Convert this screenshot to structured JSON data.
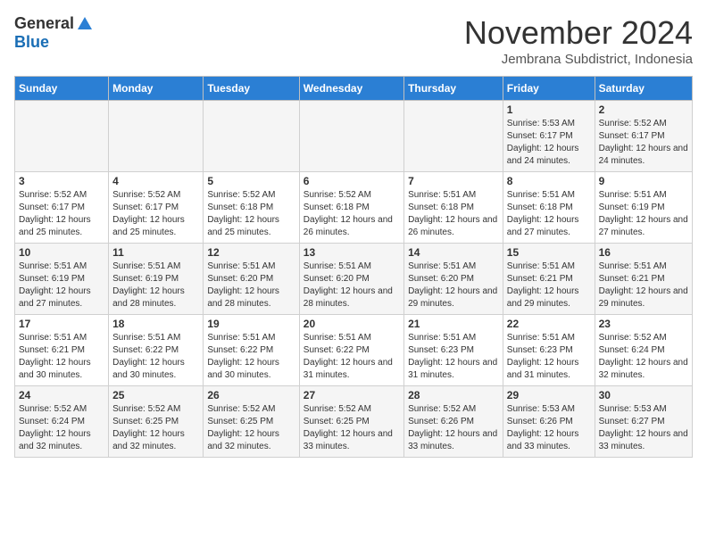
{
  "header": {
    "logo_general": "General",
    "logo_blue": "Blue",
    "month_title": "November 2024",
    "subtitle": "Jembrana Subdistrict, Indonesia"
  },
  "weekdays": [
    "Sunday",
    "Monday",
    "Tuesday",
    "Wednesday",
    "Thursday",
    "Friday",
    "Saturday"
  ],
  "weeks": [
    [
      {
        "day": "",
        "info": ""
      },
      {
        "day": "",
        "info": ""
      },
      {
        "day": "",
        "info": ""
      },
      {
        "day": "",
        "info": ""
      },
      {
        "day": "",
        "info": ""
      },
      {
        "day": "1",
        "info": "Sunrise: 5:53 AM\nSunset: 6:17 PM\nDaylight: 12 hours and 24 minutes."
      },
      {
        "day": "2",
        "info": "Sunrise: 5:52 AM\nSunset: 6:17 PM\nDaylight: 12 hours and 24 minutes."
      }
    ],
    [
      {
        "day": "3",
        "info": "Sunrise: 5:52 AM\nSunset: 6:17 PM\nDaylight: 12 hours and 25 minutes."
      },
      {
        "day": "4",
        "info": "Sunrise: 5:52 AM\nSunset: 6:17 PM\nDaylight: 12 hours and 25 minutes."
      },
      {
        "day": "5",
        "info": "Sunrise: 5:52 AM\nSunset: 6:18 PM\nDaylight: 12 hours and 25 minutes."
      },
      {
        "day": "6",
        "info": "Sunrise: 5:52 AM\nSunset: 6:18 PM\nDaylight: 12 hours and 26 minutes."
      },
      {
        "day": "7",
        "info": "Sunrise: 5:51 AM\nSunset: 6:18 PM\nDaylight: 12 hours and 26 minutes."
      },
      {
        "day": "8",
        "info": "Sunrise: 5:51 AM\nSunset: 6:18 PM\nDaylight: 12 hours and 27 minutes."
      },
      {
        "day": "9",
        "info": "Sunrise: 5:51 AM\nSunset: 6:19 PM\nDaylight: 12 hours and 27 minutes."
      }
    ],
    [
      {
        "day": "10",
        "info": "Sunrise: 5:51 AM\nSunset: 6:19 PM\nDaylight: 12 hours and 27 minutes."
      },
      {
        "day": "11",
        "info": "Sunrise: 5:51 AM\nSunset: 6:19 PM\nDaylight: 12 hours and 28 minutes."
      },
      {
        "day": "12",
        "info": "Sunrise: 5:51 AM\nSunset: 6:20 PM\nDaylight: 12 hours and 28 minutes."
      },
      {
        "day": "13",
        "info": "Sunrise: 5:51 AM\nSunset: 6:20 PM\nDaylight: 12 hours and 28 minutes."
      },
      {
        "day": "14",
        "info": "Sunrise: 5:51 AM\nSunset: 6:20 PM\nDaylight: 12 hours and 29 minutes."
      },
      {
        "day": "15",
        "info": "Sunrise: 5:51 AM\nSunset: 6:21 PM\nDaylight: 12 hours and 29 minutes."
      },
      {
        "day": "16",
        "info": "Sunrise: 5:51 AM\nSunset: 6:21 PM\nDaylight: 12 hours and 29 minutes."
      }
    ],
    [
      {
        "day": "17",
        "info": "Sunrise: 5:51 AM\nSunset: 6:21 PM\nDaylight: 12 hours and 30 minutes."
      },
      {
        "day": "18",
        "info": "Sunrise: 5:51 AM\nSunset: 6:22 PM\nDaylight: 12 hours and 30 minutes."
      },
      {
        "day": "19",
        "info": "Sunrise: 5:51 AM\nSunset: 6:22 PM\nDaylight: 12 hours and 30 minutes."
      },
      {
        "day": "20",
        "info": "Sunrise: 5:51 AM\nSunset: 6:22 PM\nDaylight: 12 hours and 31 minutes."
      },
      {
        "day": "21",
        "info": "Sunrise: 5:51 AM\nSunset: 6:23 PM\nDaylight: 12 hours and 31 minutes."
      },
      {
        "day": "22",
        "info": "Sunrise: 5:51 AM\nSunset: 6:23 PM\nDaylight: 12 hours and 31 minutes."
      },
      {
        "day": "23",
        "info": "Sunrise: 5:52 AM\nSunset: 6:24 PM\nDaylight: 12 hours and 32 minutes."
      }
    ],
    [
      {
        "day": "24",
        "info": "Sunrise: 5:52 AM\nSunset: 6:24 PM\nDaylight: 12 hours and 32 minutes."
      },
      {
        "day": "25",
        "info": "Sunrise: 5:52 AM\nSunset: 6:25 PM\nDaylight: 12 hours and 32 minutes."
      },
      {
        "day": "26",
        "info": "Sunrise: 5:52 AM\nSunset: 6:25 PM\nDaylight: 12 hours and 32 minutes."
      },
      {
        "day": "27",
        "info": "Sunrise: 5:52 AM\nSunset: 6:25 PM\nDaylight: 12 hours and 33 minutes."
      },
      {
        "day": "28",
        "info": "Sunrise: 5:52 AM\nSunset: 6:26 PM\nDaylight: 12 hours and 33 minutes."
      },
      {
        "day": "29",
        "info": "Sunrise: 5:53 AM\nSunset: 6:26 PM\nDaylight: 12 hours and 33 minutes."
      },
      {
        "day": "30",
        "info": "Sunrise: 5:53 AM\nSunset: 6:27 PM\nDaylight: 12 hours and 33 minutes."
      }
    ]
  ]
}
